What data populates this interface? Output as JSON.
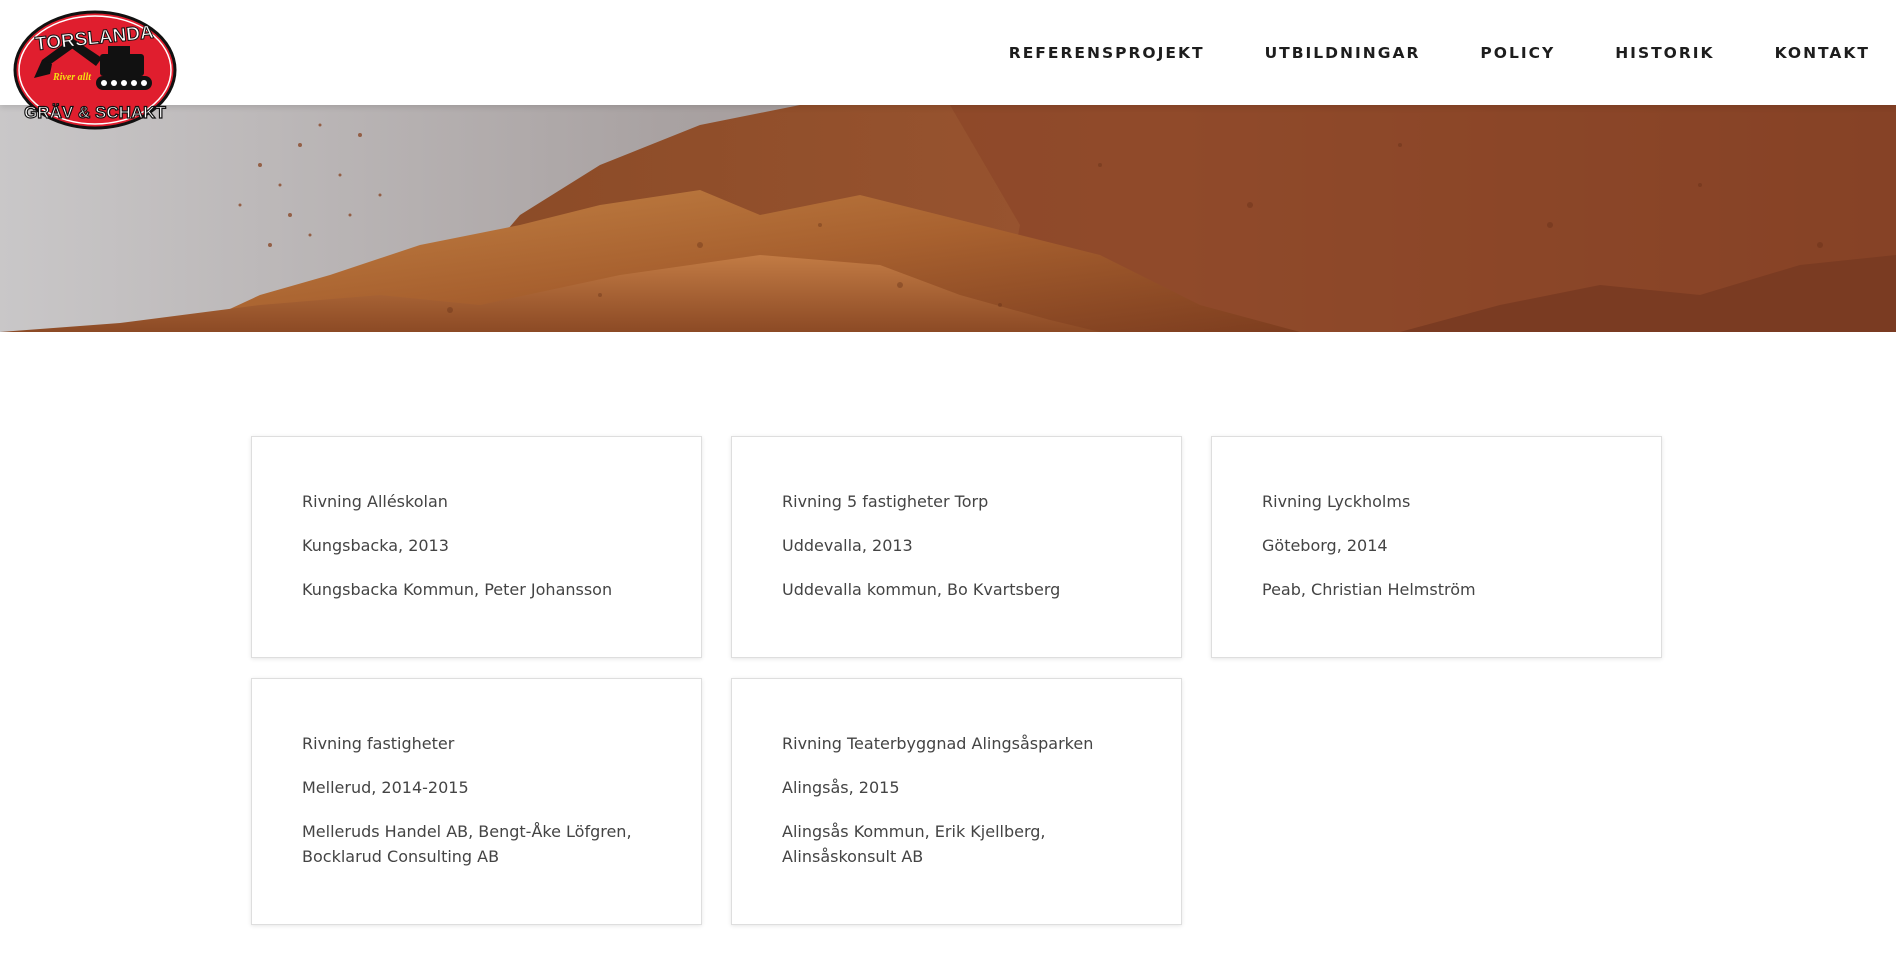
{
  "logo": {
    "top_text": "TORSLANDA",
    "bottom_text": "GRÄV & SCHAKT",
    "slogan": "River allt",
    "colors": {
      "red": "#e01e2e",
      "black": "#111111",
      "yellow": "#f5e012"
    }
  },
  "nav": {
    "items": [
      {
        "label": "REFERENSPROJEKT"
      },
      {
        "label": "UTBILDNINGAR"
      },
      {
        "label": "POLICY"
      },
      {
        "label": "HISTORIK"
      },
      {
        "label": "KONTAKT"
      }
    ]
  },
  "projects": [
    {
      "name": "Rivning Alléskolan",
      "location": "Kungsbacka, 2013",
      "client": "Kungsbacka Kommun, Peter Johansson"
    },
    {
      "name": "Rivning 5 fastigheter Torp",
      "location": "Uddevalla, 2013",
      "client": "Uddevalla kommun, Bo Kvartsberg"
    },
    {
      "name": "Rivning Lyckholms",
      "location": "Göteborg, 2014",
      "client": "Peab, Christian Helmström"
    },
    {
      "name": "Rivning fastigheter",
      "location": "Mellerud, 2014-2015",
      "client": "Melleruds Handel AB, Bengt-Åke Löfgren, Bocklarud Consulting AB"
    },
    {
      "name": "Rivning Teaterbyggnad Alingsåsparken",
      "location": "Alingsås, 2015",
      "client": "Alingsås Kommun, Erik Kjellberg, Alinsåskonsult AB"
    }
  ]
}
